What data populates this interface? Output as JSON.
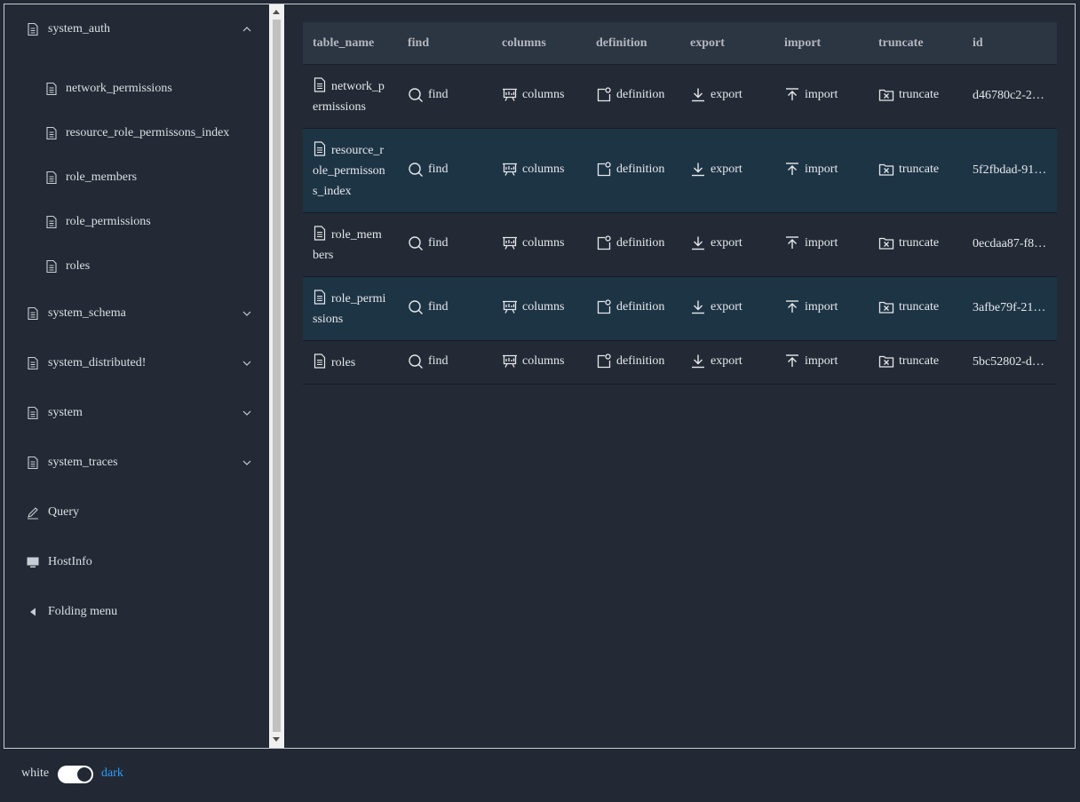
{
  "sidebar": {
    "groups": [
      {
        "label": "system_auth",
        "icon": "document-icon",
        "expanded": true,
        "children": [
          {
            "label": "network_permissions"
          },
          {
            "label": "resource_role_permissons_index"
          },
          {
            "label": "role_members"
          },
          {
            "label": "role_permissions"
          },
          {
            "label": "roles"
          }
        ]
      },
      {
        "label": "system_schema",
        "icon": "document-icon",
        "expanded": false
      },
      {
        "label": "system_distributed!",
        "icon": "document-icon",
        "expanded": false
      },
      {
        "label": "system",
        "icon": "document-icon",
        "expanded": false
      },
      {
        "label": "system_traces",
        "icon": "document-icon",
        "expanded": false
      }
    ],
    "extra": [
      {
        "label": "Query",
        "icon": "pencil-icon"
      },
      {
        "label": "HostInfo",
        "icon": "monitor-icon"
      },
      {
        "label": "Folding menu",
        "icon": "caret-left-icon"
      }
    ]
  },
  "table": {
    "headers": [
      "table_name",
      "find",
      "columns",
      "definition",
      "export",
      "import",
      "truncate",
      "id"
    ],
    "actions": [
      "find",
      "columns",
      "definition",
      "export",
      "import",
      "truncate"
    ],
    "rows": [
      {
        "name_lines": [
          "network_p",
          "ermissions"
        ],
        "id": "d46780c2-2…"
      },
      {
        "name_lines": [
          "resource_r",
          "ole_permisson",
          "s_index"
        ],
        "id": "5f2fbdad-91…"
      },
      {
        "name_lines": [
          "role_mem",
          "bers"
        ],
        "id": "0ecdaa87-f8…"
      },
      {
        "name_lines": [
          "role_permi",
          "ssions"
        ],
        "id": "3afbe79f-21…"
      },
      {
        "name_lines": [
          "roles"
        ],
        "id": "5bc52802-d…"
      }
    ]
  },
  "theme": {
    "white_label": "white",
    "dark_label": "dark",
    "mode": "dark",
    "accent": "#2f9bff"
  }
}
